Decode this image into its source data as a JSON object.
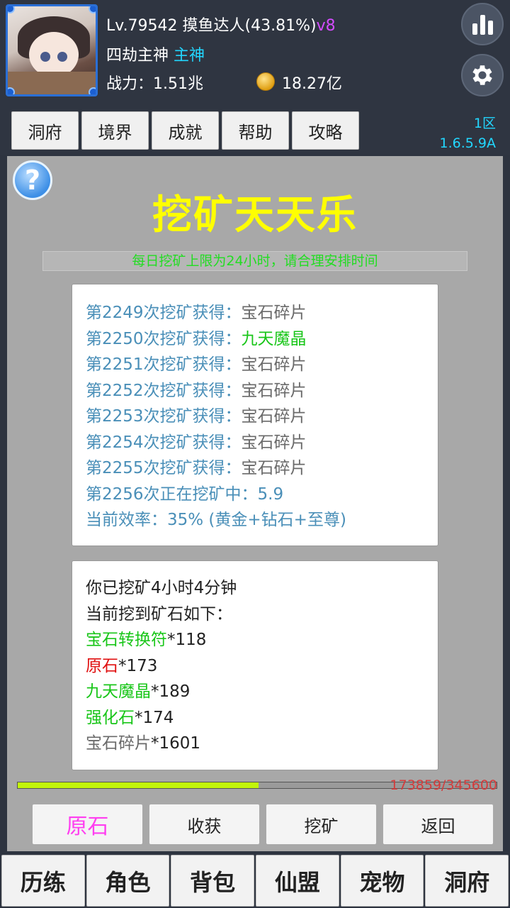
{
  "header": {
    "level": "Lv.79542",
    "title": "摸鱼达人(43.81%)",
    "vip": "v8",
    "rank": "四劫主神",
    "rank_tag": "主神",
    "power_label": "战力：",
    "power_value": "1.51兆",
    "gold": "18.27亿",
    "server": "1区",
    "version": "1.6.5.9A",
    "icons": [
      "stats-icon",
      "gear-icon",
      "coin-icon"
    ]
  },
  "tabs": [
    "洞府",
    "境界",
    "成就",
    "帮助",
    "攻略"
  ],
  "main": {
    "help_glyph": "?",
    "title": "挖矿天天乐",
    "notice": "每日挖矿上限为24小时，请合理安排时间",
    "log": [
      {
        "prefix": "第2249次挖矿获得：",
        "item": "宝石碎片",
        "color": "grey"
      },
      {
        "prefix": "第2250次挖矿获得：",
        "item": "九天魔晶",
        "color": "green"
      },
      {
        "prefix": "第2251次挖矿获得：",
        "item": "宝石碎片",
        "color": "grey"
      },
      {
        "prefix": "第2252次挖矿获得：",
        "item": "宝石碎片",
        "color": "grey"
      },
      {
        "prefix": "第2253次挖矿获得：",
        "item": "宝石碎片",
        "color": "grey"
      },
      {
        "prefix": "第2254次挖矿获得：",
        "item": "宝石碎片",
        "color": "grey"
      },
      {
        "prefix": "第2255次挖矿获得：",
        "item": "宝石碎片",
        "color": "grey"
      }
    ],
    "current": "第2256次正在挖矿中：5.9",
    "efficiency": "当前效率：35% (黄金+钻石+至尊)",
    "mined_time": "你已挖矿4小时4分钟",
    "mined_header": "当前挖到矿石如下：",
    "results": [
      {
        "name": "宝石转换符",
        "count": "*118",
        "color": "green"
      },
      {
        "name": "原石",
        "count": "*173",
        "color": "red"
      },
      {
        "name": "九天魔晶",
        "count": "*189",
        "color": "green"
      },
      {
        "name": "强化石",
        "count": "*174",
        "color": "green"
      },
      {
        "name": "宝石碎片",
        "count": "*1601",
        "color": "grey"
      }
    ],
    "progress_text": "173859/345600",
    "progress_fraction": 0.503
  },
  "actions": [
    "原石",
    "收获",
    "挖矿",
    "返回"
  ],
  "bottom_nav": [
    "历练",
    "角色",
    "背包",
    "仙盟",
    "宠物",
    "洞府"
  ],
  "colors": {
    "accent_cyan": "#22d7ff",
    "title_yellow": "#ffff00",
    "notice_green": "#22dd22",
    "progress_fill": "#c2f50a",
    "progress_text": "#d43b3b",
    "vip_purple": "#d44cff",
    "pink_button": "#ff3ef0"
  }
}
